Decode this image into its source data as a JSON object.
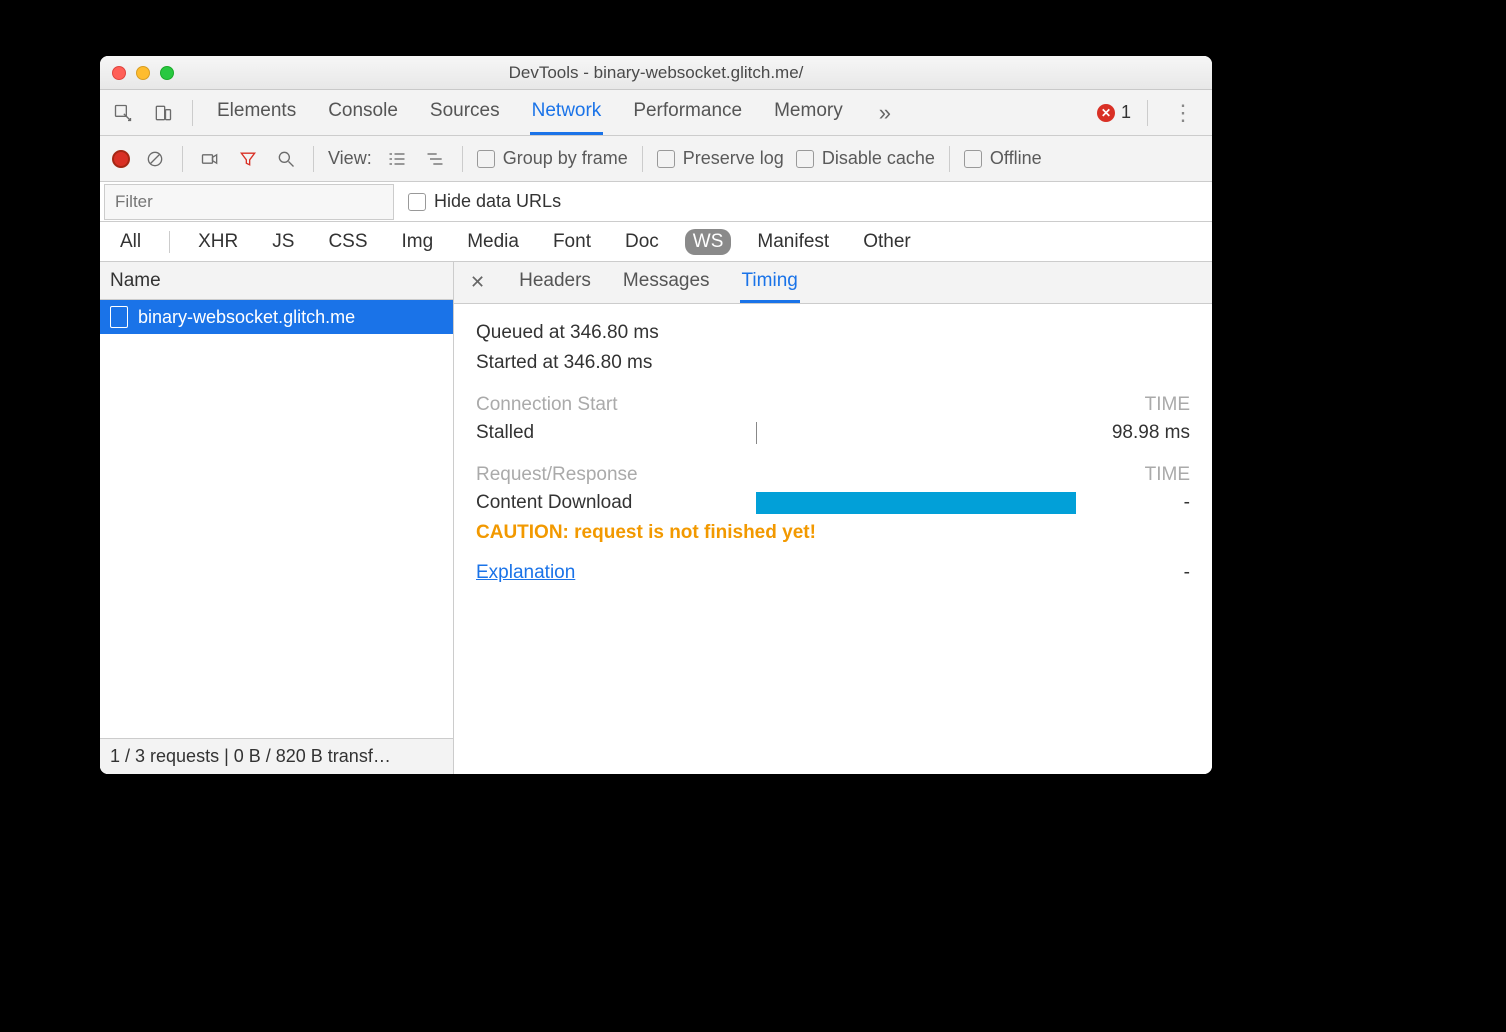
{
  "window": {
    "title": "DevTools - binary-websocket.glitch.me/"
  },
  "tabs": {
    "items": [
      "Elements",
      "Console",
      "Sources",
      "Network",
      "Performance",
      "Memory"
    ],
    "active_index": 3,
    "overflow_glyph": "»",
    "error_count": "1"
  },
  "toolbar": {
    "view_label": "View:",
    "group_by_frame": "Group by frame",
    "preserve_log": "Preserve log",
    "disable_cache": "Disable cache",
    "offline": "Offline"
  },
  "filter": {
    "placeholder": "Filter",
    "hide_data_urls": "Hide data URLs"
  },
  "type_filters": {
    "items": [
      "All",
      "XHR",
      "JS",
      "CSS",
      "Img",
      "Media",
      "Font",
      "Doc",
      "WS",
      "Manifest",
      "Other"
    ],
    "active": "WS"
  },
  "requests": {
    "name_header": "Name",
    "items": [
      {
        "name": "binary-websocket.glitch.me",
        "selected": true
      }
    ],
    "footer": "1 / 3 requests | 0 B / 820 B transf…"
  },
  "detail": {
    "tabs": [
      "Headers",
      "Messages",
      "Timing"
    ],
    "active_index": 2,
    "timing": {
      "queued_label": "Queued at 346.80 ms",
      "started_label": "Started at 346.80 ms",
      "conn_start_header": "Connection Start",
      "time_header": "TIME",
      "stalled_label": "Stalled",
      "stalled_value": "98.98 ms",
      "req_resp_header": "Request/Response",
      "content_dl_label": "Content Download",
      "content_dl_value": "-",
      "caution": "CAUTION: request is not finished yet!",
      "explanation": "Explanation",
      "explanation_value": "-"
    }
  }
}
